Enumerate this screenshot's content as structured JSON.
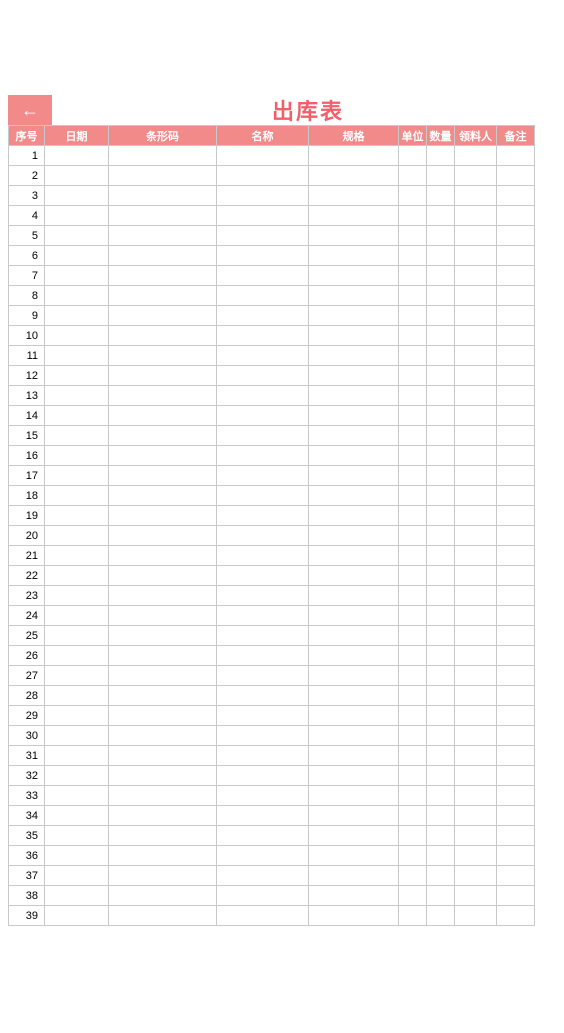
{
  "title": "出库表",
  "back_arrow": "←",
  "colors": {
    "accent": "#f28a8a",
    "title_text": "#f25f6a",
    "header_text": "#ffffff",
    "border": "#c9c9c9"
  },
  "columns": [
    {
      "key": "seq",
      "label": "序号"
    },
    {
      "key": "date",
      "label": "日期"
    },
    {
      "key": "barcode",
      "label": "条形码"
    },
    {
      "key": "name",
      "label": "名称"
    },
    {
      "key": "spec",
      "label": "规格"
    },
    {
      "key": "unit",
      "label": "单位"
    },
    {
      "key": "qty",
      "label": "数量"
    },
    {
      "key": "person",
      "label": "领料人"
    },
    {
      "key": "note",
      "label": "备注"
    }
  ],
  "rows": [
    {
      "seq": "1",
      "date": "",
      "barcode": "",
      "name": "",
      "spec": "",
      "unit": "",
      "qty": "",
      "person": "",
      "note": ""
    },
    {
      "seq": "2",
      "date": "",
      "barcode": "",
      "name": "",
      "spec": "",
      "unit": "",
      "qty": "",
      "person": "",
      "note": ""
    },
    {
      "seq": "3",
      "date": "",
      "barcode": "",
      "name": "",
      "spec": "",
      "unit": "",
      "qty": "",
      "person": "",
      "note": ""
    },
    {
      "seq": "4",
      "date": "",
      "barcode": "",
      "name": "",
      "spec": "",
      "unit": "",
      "qty": "",
      "person": "",
      "note": ""
    },
    {
      "seq": "5",
      "date": "",
      "barcode": "",
      "name": "",
      "spec": "",
      "unit": "",
      "qty": "",
      "person": "",
      "note": ""
    },
    {
      "seq": "6",
      "date": "",
      "barcode": "",
      "name": "",
      "spec": "",
      "unit": "",
      "qty": "",
      "person": "",
      "note": ""
    },
    {
      "seq": "7",
      "date": "",
      "barcode": "",
      "name": "",
      "spec": "",
      "unit": "",
      "qty": "",
      "person": "",
      "note": ""
    },
    {
      "seq": "8",
      "date": "",
      "barcode": "",
      "name": "",
      "spec": "",
      "unit": "",
      "qty": "",
      "person": "",
      "note": ""
    },
    {
      "seq": "9",
      "date": "",
      "barcode": "",
      "name": "",
      "spec": "",
      "unit": "",
      "qty": "",
      "person": "",
      "note": ""
    },
    {
      "seq": "10",
      "date": "",
      "barcode": "",
      "name": "",
      "spec": "",
      "unit": "",
      "qty": "",
      "person": "",
      "note": ""
    },
    {
      "seq": "11",
      "date": "",
      "barcode": "",
      "name": "",
      "spec": "",
      "unit": "",
      "qty": "",
      "person": "",
      "note": ""
    },
    {
      "seq": "12",
      "date": "",
      "barcode": "",
      "name": "",
      "spec": "",
      "unit": "",
      "qty": "",
      "person": "",
      "note": ""
    },
    {
      "seq": "13",
      "date": "",
      "barcode": "",
      "name": "",
      "spec": "",
      "unit": "",
      "qty": "",
      "person": "",
      "note": ""
    },
    {
      "seq": "14",
      "date": "",
      "barcode": "",
      "name": "",
      "spec": "",
      "unit": "",
      "qty": "",
      "person": "",
      "note": ""
    },
    {
      "seq": "15",
      "date": "",
      "barcode": "",
      "name": "",
      "spec": "",
      "unit": "",
      "qty": "",
      "person": "",
      "note": ""
    },
    {
      "seq": "16",
      "date": "",
      "barcode": "",
      "name": "",
      "spec": "",
      "unit": "",
      "qty": "",
      "person": "",
      "note": ""
    },
    {
      "seq": "17",
      "date": "",
      "barcode": "",
      "name": "",
      "spec": "",
      "unit": "",
      "qty": "",
      "person": "",
      "note": ""
    },
    {
      "seq": "18",
      "date": "",
      "barcode": "",
      "name": "",
      "spec": "",
      "unit": "",
      "qty": "",
      "person": "",
      "note": ""
    },
    {
      "seq": "19",
      "date": "",
      "barcode": "",
      "name": "",
      "spec": "",
      "unit": "",
      "qty": "",
      "person": "",
      "note": ""
    },
    {
      "seq": "20",
      "date": "",
      "barcode": "",
      "name": "",
      "spec": "",
      "unit": "",
      "qty": "",
      "person": "",
      "note": ""
    },
    {
      "seq": "21",
      "date": "",
      "barcode": "",
      "name": "",
      "spec": "",
      "unit": "",
      "qty": "",
      "person": "",
      "note": ""
    },
    {
      "seq": "22",
      "date": "",
      "barcode": "",
      "name": "",
      "spec": "",
      "unit": "",
      "qty": "",
      "person": "",
      "note": ""
    },
    {
      "seq": "23",
      "date": "",
      "barcode": "",
      "name": "",
      "spec": "",
      "unit": "",
      "qty": "",
      "person": "",
      "note": ""
    },
    {
      "seq": "24",
      "date": "",
      "barcode": "",
      "name": "",
      "spec": "",
      "unit": "",
      "qty": "",
      "person": "",
      "note": ""
    },
    {
      "seq": "25",
      "date": "",
      "barcode": "",
      "name": "",
      "spec": "",
      "unit": "",
      "qty": "",
      "person": "",
      "note": ""
    },
    {
      "seq": "26",
      "date": "",
      "barcode": "",
      "name": "",
      "spec": "",
      "unit": "",
      "qty": "",
      "person": "",
      "note": ""
    },
    {
      "seq": "27",
      "date": "",
      "barcode": "",
      "name": "",
      "spec": "",
      "unit": "",
      "qty": "",
      "person": "",
      "note": ""
    },
    {
      "seq": "28",
      "date": "",
      "barcode": "",
      "name": "",
      "spec": "",
      "unit": "",
      "qty": "",
      "person": "",
      "note": ""
    },
    {
      "seq": "29",
      "date": "",
      "barcode": "",
      "name": "",
      "spec": "",
      "unit": "",
      "qty": "",
      "person": "",
      "note": ""
    },
    {
      "seq": "30",
      "date": "",
      "barcode": "",
      "name": "",
      "spec": "",
      "unit": "",
      "qty": "",
      "person": "",
      "note": ""
    },
    {
      "seq": "31",
      "date": "",
      "barcode": "",
      "name": "",
      "spec": "",
      "unit": "",
      "qty": "",
      "person": "",
      "note": ""
    },
    {
      "seq": "32",
      "date": "",
      "barcode": "",
      "name": "",
      "spec": "",
      "unit": "",
      "qty": "",
      "person": "",
      "note": ""
    },
    {
      "seq": "33",
      "date": "",
      "barcode": "",
      "name": "",
      "spec": "",
      "unit": "",
      "qty": "",
      "person": "",
      "note": ""
    },
    {
      "seq": "34",
      "date": "",
      "barcode": "",
      "name": "",
      "spec": "",
      "unit": "",
      "qty": "",
      "person": "",
      "note": ""
    },
    {
      "seq": "35",
      "date": "",
      "barcode": "",
      "name": "",
      "spec": "",
      "unit": "",
      "qty": "",
      "person": "",
      "note": ""
    },
    {
      "seq": "36",
      "date": "",
      "barcode": "",
      "name": "",
      "spec": "",
      "unit": "",
      "qty": "",
      "person": "",
      "note": ""
    },
    {
      "seq": "37",
      "date": "",
      "barcode": "",
      "name": "",
      "spec": "",
      "unit": "",
      "qty": "",
      "person": "",
      "note": ""
    },
    {
      "seq": "38",
      "date": "",
      "barcode": "",
      "name": "",
      "spec": "",
      "unit": "",
      "qty": "",
      "person": "",
      "note": ""
    },
    {
      "seq": "39",
      "date": "",
      "barcode": "",
      "name": "",
      "spec": "",
      "unit": "",
      "qty": "",
      "person": "",
      "note": ""
    }
  ]
}
